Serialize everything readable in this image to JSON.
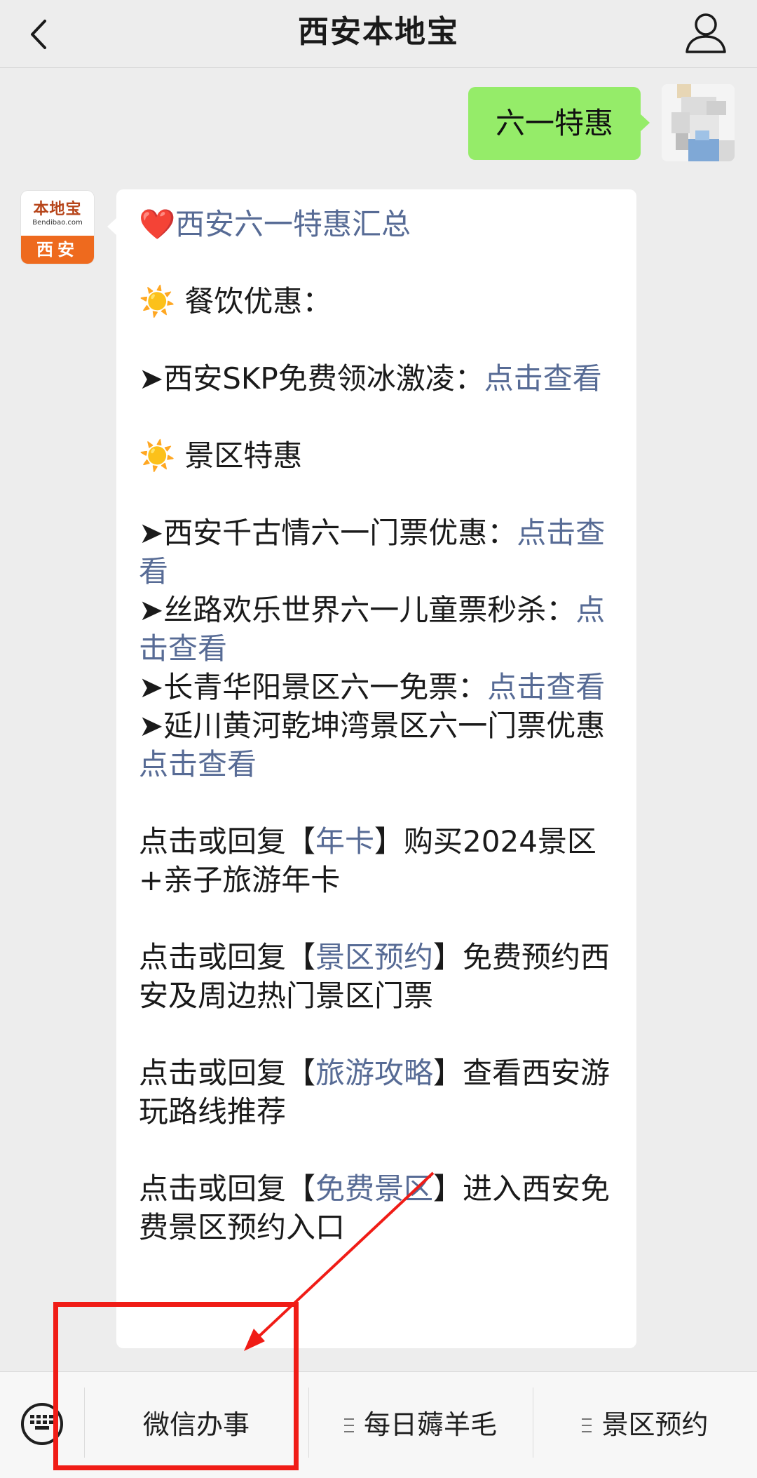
{
  "header": {
    "title": "西安本地宝",
    "back_icon": "chevron-left-icon",
    "profile_icon": "person-icon"
  },
  "sent_message": {
    "text": "六一特惠"
  },
  "bot_avatar": {
    "brand": "本地宝",
    "domain": "Bendibao.com",
    "city": "西安",
    "accent_color": "#ee6a1e"
  },
  "message": {
    "heart_emoji": "❤️",
    "sun_emoji": "☀️",
    "title_link": "西安六一特惠汇总",
    "section_food": "餐饮优惠：",
    "item_skp": "➤西安SKP免费领冰激凌：",
    "section_scenic": "景区特惠",
    "item_qiangu": "➤西安千古情六一门票优惠：",
    "item_silk": "➤丝路欢乐世界六一儿童票秒杀：",
    "item_changqing": "➤长青华阳景区六一免票：",
    "item_yanchuan": "➤延川黄河乾坤湾景区六一门票优惠",
    "link_view": "点击查看",
    "reply_prefix": "点击或回复【",
    "reply_suffix_bracket": "】",
    "kw_annual": "年卡",
    "annual_text": "购买2024景区+亲子旅游年卡",
    "kw_booking": "景区预约",
    "booking_text": "免费预约西安及周边热门景区门票",
    "kw_guide": "旅游攻略",
    "guide_text": "查看西安游玩路线推荐",
    "kw_free": "免费景区",
    "free_text": "进入西安免费景区预约入口"
  },
  "bottom_menu": {
    "keyboard_icon": "keyboard-icon",
    "items": [
      {
        "label": "微信办事"
      },
      {
        "label": "每日薅羊毛"
      },
      {
        "label": "景区预约"
      }
    ]
  },
  "annotation": {
    "color": "#f01c16"
  },
  "colors": {
    "background": "#ededed",
    "sent_bubble": "#95ec69",
    "link": "#576b95"
  }
}
